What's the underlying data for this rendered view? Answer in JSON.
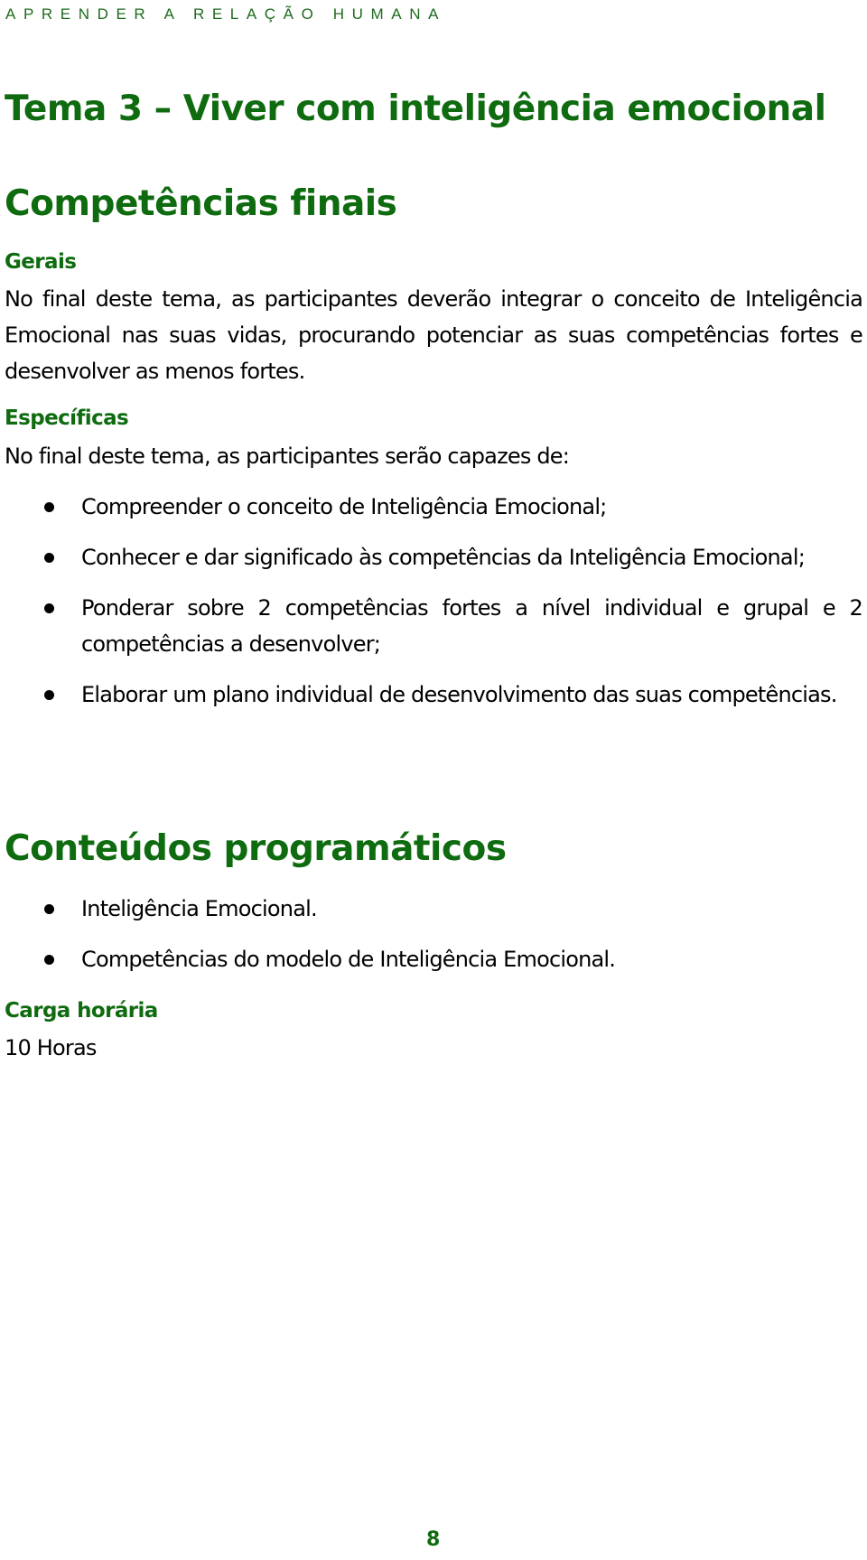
{
  "header": {
    "running_title": "APRENDER A RELAÇÃO HUMANA"
  },
  "title": "Tema 3 – Viver com inteligência emocional",
  "competencias": {
    "heading": "Competências finais",
    "gerais": {
      "heading": "Gerais",
      "text": "No final deste tema, as participantes deverão integrar o conceito de Inteligência Emocional nas suas vidas, procurando potenciar as suas competências fortes e desenvolver as menos fortes."
    },
    "especificas": {
      "heading": "Específicas",
      "intro": "No final deste tema, as participantes serão capazes de:",
      "items": [
        "Compreender o conceito de Inteligência Emocional;",
        "Conhecer e dar significado às competências da Inteligência Emocional;",
        "Ponderar sobre 2 competências fortes a nível individual e grupal e 2 competências a desenvolver;",
        "Elaborar um plano individual de desenvolvimento das suas competências."
      ]
    }
  },
  "conteudos": {
    "heading": "Conteúdos programáticos",
    "items": [
      "Inteligência Emocional.",
      "Competências do modelo de Inteligência Emocional."
    ]
  },
  "carga": {
    "heading": "Carga horária",
    "value": "10 Horas"
  },
  "page_number": "8",
  "colors": {
    "heading_green": "#0f6b0f",
    "body_text": "#000000"
  }
}
